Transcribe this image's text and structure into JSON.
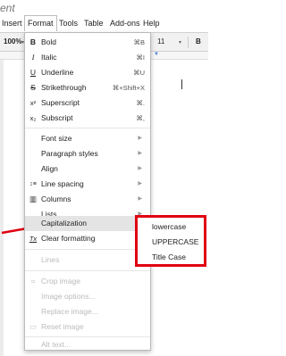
{
  "doc_title": "ent",
  "menubar": {
    "insert": "Insert",
    "format": "Format",
    "tools": "Tools",
    "table": "Table",
    "addons": "Add-ons",
    "help": "Help"
  },
  "toolbar": {
    "zoom": "100%",
    "dropdown_arrow": "▾",
    "font_size": "11",
    "bold": "B"
  },
  "format_menu": {
    "bold": {
      "icon": "B",
      "label": "Bold",
      "shortcut": "⌘B"
    },
    "italic": {
      "icon": "I",
      "label": "Italic",
      "shortcut": "⌘I"
    },
    "underline": {
      "icon": "U",
      "label": "Underline",
      "shortcut": "⌘U"
    },
    "strikethrough": {
      "icon": "S",
      "label": "Strikethrough",
      "shortcut": "⌘+Shift+X"
    },
    "superscript": {
      "icon": "x²",
      "label": "Superscript",
      "shortcut": "⌘."
    },
    "subscript": {
      "icon": "x₂",
      "label": "Subscript",
      "shortcut": "⌘,"
    },
    "font_size": {
      "label": "Font size"
    },
    "paragraph_styles": {
      "label": "Paragraph styles"
    },
    "align": {
      "label": "Align"
    },
    "line_spacing": {
      "icon": "↕≡",
      "label": "Line spacing"
    },
    "columns": {
      "icon": "▥",
      "label": "Columns"
    },
    "lists": {
      "label": "Lists"
    },
    "capitalization": {
      "label": "Capitalization"
    },
    "clear_formatting": {
      "icon": "Tx",
      "label": "Clear formatting",
      "shortcut": "⌘\\"
    },
    "lines": {
      "label": "Lines"
    },
    "crop_image": {
      "icon": "⌗",
      "label": "Crop image"
    },
    "image_options": {
      "label": "Image options..."
    },
    "replace_image": {
      "label": "Replace image..."
    },
    "reset_image": {
      "icon": "▭",
      "label": "Reset image"
    },
    "alt_text": {
      "label": "Alt text..."
    },
    "submenu_arrow": "▶"
  },
  "capitalization_submenu": {
    "lowercase": "lowercase",
    "uppercase": "UPPERCASE",
    "title_case": "Title Case"
  },
  "colors": {
    "highlight_border": "#e00012",
    "arrow": "#e00012",
    "menu_highlight": "#e4e4e4",
    "disabled_text": "#bbbbbb"
  }
}
